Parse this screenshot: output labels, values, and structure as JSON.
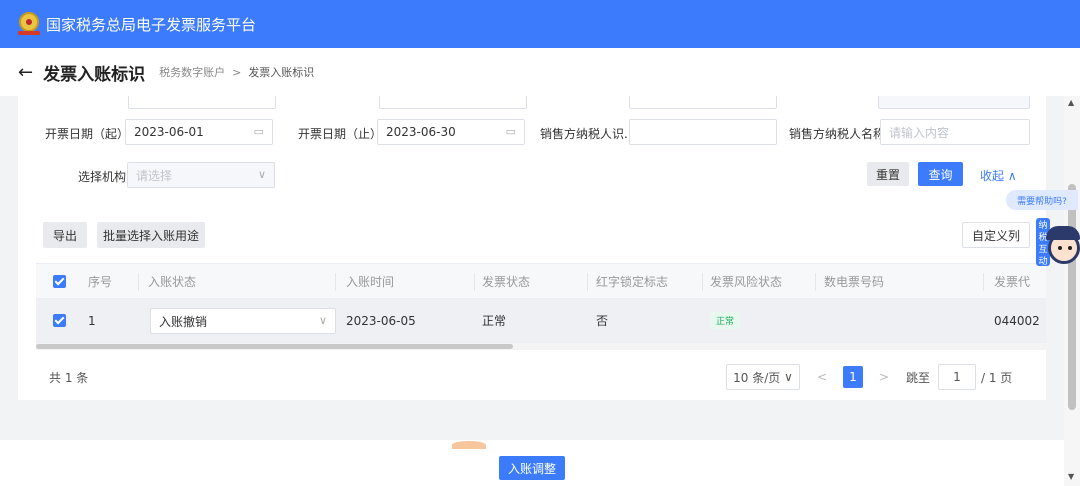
{
  "header": {
    "platform_title": "国家税务总局电子发票服务平台"
  },
  "page": {
    "back_icon": "←",
    "title": "发票入账标识",
    "breadcrumb": {
      "parent": "税务数字账户",
      "separator": ">",
      "current": "发票入账标识"
    }
  },
  "filters": {
    "issue_date_start": {
      "label": "开票日期（起）",
      "value": "2023-06-01"
    },
    "issue_date_end": {
      "label": "开票日期（止）",
      "value": "2023-06-30"
    },
    "seller_tax_id": {
      "label": "销售方纳税人识...",
      "value": ""
    },
    "seller_name": {
      "label": "销售方纳税人名称",
      "placeholder": "请输入内容"
    },
    "org": {
      "label": "选择机构",
      "placeholder": "请选择"
    },
    "reset_label": "重置",
    "query_label": "查询",
    "collapse_label": "收起",
    "collapse_icon": "∧"
  },
  "toolbar": {
    "export_label": "导出",
    "batch_label": "批量选择入账用途",
    "custom_columns_label": "自定义列"
  },
  "table": {
    "columns": [
      "序号",
      "入账状态",
      "入账时间",
      "发票状态",
      "红字锁定标志",
      "发票风险状态",
      "数电票号码",
      "发票代"
    ],
    "rows": [
      {
        "index": "1",
        "status": "入账撤销",
        "time": "2023-06-05",
        "invoice_status": "正常",
        "red_lock": "否",
        "risk_status": "正常",
        "e_invoice_no": "",
        "invoice_code": "044002"
      }
    ]
  },
  "pagination": {
    "total": "共 1 条",
    "page_size": "10 条/页",
    "prev": "<",
    "current_page": "1",
    "next": ">",
    "jump_label": "跳至",
    "jump_value": "1",
    "page_total": "/ 1 页"
  },
  "footer": {
    "adjust_label": "入账调整"
  },
  "side": {
    "help_label": "需要帮助吗?",
    "assistant_label": "纳税互动"
  },
  "colors": {
    "primary": "#3c7cfc",
    "success": "#1aab5a"
  }
}
